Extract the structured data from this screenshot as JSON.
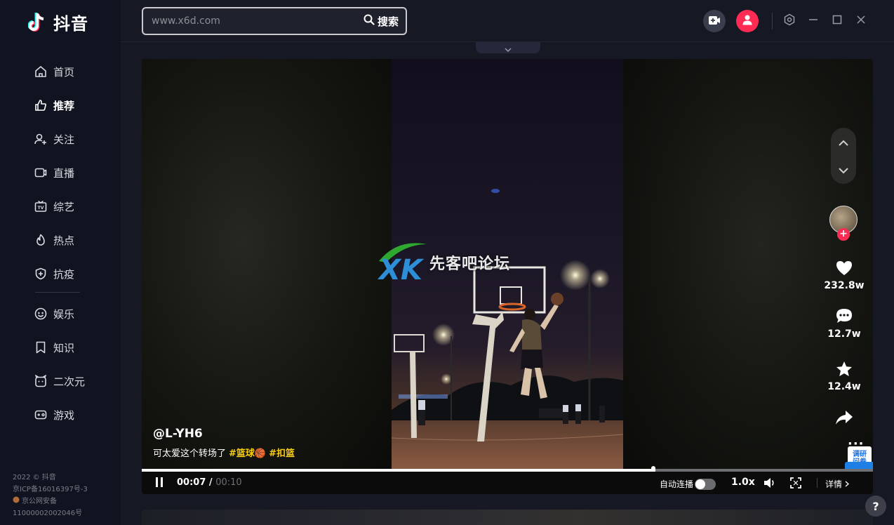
{
  "app": {
    "logo_text": "抖音"
  },
  "sidebar": {
    "items": [
      {
        "label": "首页",
        "icon": "home-icon"
      },
      {
        "label": "推荐",
        "icon": "thumbs-up-icon",
        "active": true
      },
      {
        "label": "关注",
        "icon": "person-add-icon"
      },
      {
        "label": "直播",
        "icon": "live-icon"
      },
      {
        "label": "综艺",
        "icon": "tv-icon"
      },
      {
        "label": "热点",
        "icon": "flame-icon"
      },
      {
        "label": "抗疫",
        "icon": "shield-plus-icon"
      }
    ],
    "items2": [
      {
        "label": "娱乐",
        "icon": "smile-icon"
      },
      {
        "label": "知识",
        "icon": "bookmark-icon"
      },
      {
        "label": "二次元",
        "icon": "anime-icon"
      },
      {
        "label": "游戏",
        "icon": "gamepad-icon"
      }
    ],
    "footer": {
      "copyright": "2022 © 抖音",
      "icp": "京ICP备16016397号-3",
      "police": "京公网安备",
      "police_no": "11000002002046号"
    }
  },
  "search": {
    "placeholder": "www.x6d.com",
    "button_label": "搜索"
  },
  "watermark": {
    "text": "先客吧论坛"
  },
  "video": {
    "author": "@L-YH6",
    "description": "可太爱这个转场了",
    "tags": [
      "#篮球🏀",
      "#扣篮"
    ],
    "likes": "232.8w",
    "comments": "12.7w",
    "favorites": "12.4w",
    "more": "···"
  },
  "survey": {
    "label_line1": "调研",
    "label_line2": "问卷"
  },
  "controls": {
    "current_time": "00:07 /",
    "total_time": "00:10",
    "progress": 0.7,
    "autoplay_label": "自动连播",
    "autoplay_on": false,
    "speed": "1.0x",
    "details": "详情"
  },
  "help": {
    "label": "?"
  },
  "colors": {
    "accent": "#fe2c55",
    "tag": "#face15",
    "background": "#161823",
    "sidebar": "#101320"
  }
}
